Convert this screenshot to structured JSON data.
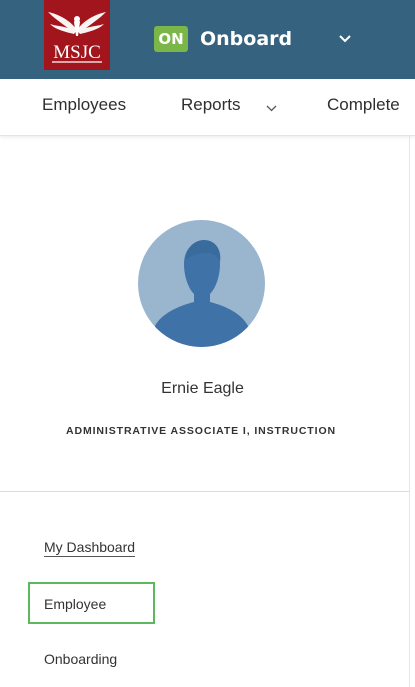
{
  "header": {
    "logo_text": "MSJC",
    "app_badge": "ON",
    "app_name": "Onboard",
    "app_switch_icon": "chevron-down-icon"
  },
  "nav": {
    "items": [
      {
        "label": "Employees"
      },
      {
        "label": "Reports",
        "icon": "chevron-down-icon"
      },
      {
        "label": "Complete"
      }
    ]
  },
  "profile": {
    "avatar_icon": "user-silhouette-icon",
    "name": "Ernie Eagle",
    "title": "ADMINISTRATIVE ASSOCIATE I, INSTRUCTION"
  },
  "menu": {
    "items": [
      {
        "label": "My Dashboard"
      },
      {
        "label": "Employee"
      },
      {
        "label": "Onboarding"
      }
    ]
  },
  "colors": {
    "header_bg": "#34627f",
    "logo_bg": "#a3151c",
    "badge_bg": "#7ab648",
    "focus_border": "#5cb85c"
  }
}
